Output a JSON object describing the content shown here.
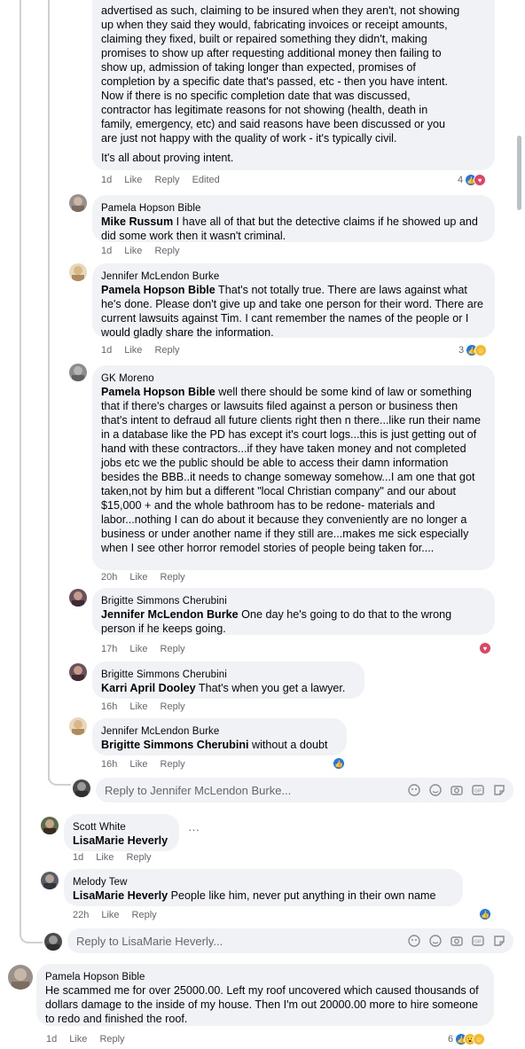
{
  "comments": {
    "top": {
      "text_lines": [
        "advertised as such, claiming to be insured when they aren't, not showing",
        "up when they said they would, fabricating invoices or receipt amounts,",
        "claiming they fixed, built or repaired something they didn't, making",
        "promises to show up after requesting additional money then failing to",
        "show up, admission of taking longer than expected, promises of",
        "completion by a specific date that's passed, etc - then you have intent.",
        "Now if there is no specific completion date that was discussed,",
        "contractor has legitimate reasons for not showing (health, death in",
        "family, emergency, etc) and said reasons have been discussed or you",
        "are just not happy with the quality of work - it's typically civil."
      ],
      "text2": "It's all about proving intent.",
      "time": "1d",
      "like": "Like",
      "reply": "Reply",
      "edited": "Edited",
      "react_count": "4"
    },
    "c1": {
      "author": "Pamela Hopson Bible",
      "mention": "Mike Russum",
      "text": " I have all of that but the detective claims if he showed up and did some work then it wasn't criminal.",
      "time": "1d",
      "like": "Like",
      "reply": "Reply"
    },
    "c2": {
      "author": "Jennifer McLendon Burke",
      "mention": "Pamela Hopson Bible",
      "text": " That's not totally true. There are laws against what he's done. Please don't give up and take one person for their word. There are current lawsuits against Tim. I cant remember the names of the people or I would gladly share the information.",
      "time": "1d",
      "like": "Like",
      "reply": "Reply",
      "react_count": "3"
    },
    "c3": {
      "author": "GK Moreno",
      "mention": "Pamela Hopson Bible",
      "text": " well there should be some kind of law or something that if there's charges or lawsuits filed against a person or business then that's intent to defraud all future clients right then n there...like run their name in a database like the PD has except it's court logs...this is just getting out of hand with these contractors...if they have taken money and not completed jobs etc we the public should be able to access their damn information besides the BBB..it needs to change someway somehow...I am one that got taken,not by him but a different \"local Christian company\" and our about $15,000 + and the whole bathroom has to be redone- materials and labor...nothing I can do about it because they conveniently are no longer a business or under another name if they still are...makes me sick especially when I see other horror remodel stories of people being taken for....",
      "time": "20h",
      "like": "Like",
      "reply": "Reply"
    },
    "c4": {
      "author": "Brigitte Simmons Cherubini",
      "mention": "Jennifer McLendon Burke",
      "text": " One day he's going to do that to the wrong person if he keeps going.",
      "time": "17h",
      "like": "Like",
      "reply": "Reply"
    },
    "c5": {
      "author": "Brigitte Simmons Cherubini",
      "mention": "Karri April Dooley",
      "text": " That's when you get a lawyer.",
      "time": "16h",
      "like": "Like",
      "reply": "Reply"
    },
    "c6": {
      "author": "Jennifer McLendon Burke",
      "mention": "Brigitte Simmons Cherubini",
      "text": " without a doubt",
      "time": "16h",
      "like": "Like",
      "reply": "Reply"
    },
    "reply_box_1": {
      "placeholder": "Reply to Jennifer McLendon Burke..."
    },
    "c7": {
      "author": "Scott White",
      "mention": "LisaMarie Heverly",
      "text": "",
      "more": "···",
      "time": "1d",
      "like": "Like",
      "reply": "Reply"
    },
    "c8": {
      "author": "Melody Tew",
      "mention": "LisaMarie Heverly",
      "text": " People like him, never put anything in their own name",
      "time": "22h",
      "like": "Like",
      "reply": "Reply"
    },
    "reply_box_2": {
      "placeholder": "Reply to LisaMarie Heverly..."
    },
    "c9": {
      "author": "Pamela Hopson Bible",
      "text": "He scammed me for over 25000.00. Left my roof uncovered which caused thousands of dollars damage to the inside of my house. Then I'm out 20000.00 more to hire someone to redo and finished the roof.",
      "time": "1d",
      "like": "Like",
      "reply": "Reply",
      "react_count": "6"
    }
  },
  "colors": {
    "bubble": "#f0f2f5",
    "like": "#1877f2",
    "love": "#e4405f",
    "meta": "#65676b"
  }
}
